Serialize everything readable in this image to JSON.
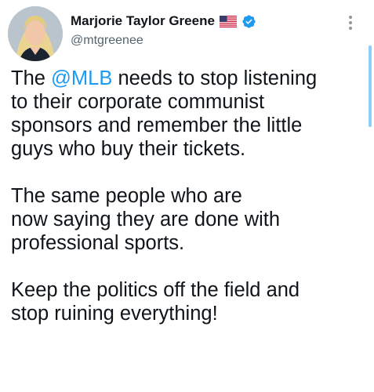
{
  "user": {
    "display_name": "Marjorie Taylor Greene",
    "handle": "@mtgreenee",
    "flag_icon": "us-flag-icon",
    "verified_icon": "verified-badge-icon",
    "verified_color": "#1d9bf0"
  },
  "tweet": {
    "para1_prefix": "The ",
    "para1_mention": "@MLB",
    "para1_lines": [
      " needs to stop listening",
      "to their corporate communist",
      "sponsors and remember the little",
      "guys who buy their tickets."
    ],
    "para2_lines": [
      "The same people who are",
      "now saying they are done with",
      "professional sports."
    ],
    "para3_lines": [
      "Keep the politics off the field and",
      "stop ruining everything!"
    ]
  },
  "colors": {
    "accent": "#1d9bf0",
    "text": "#0f1419",
    "secondary": "#536471"
  }
}
